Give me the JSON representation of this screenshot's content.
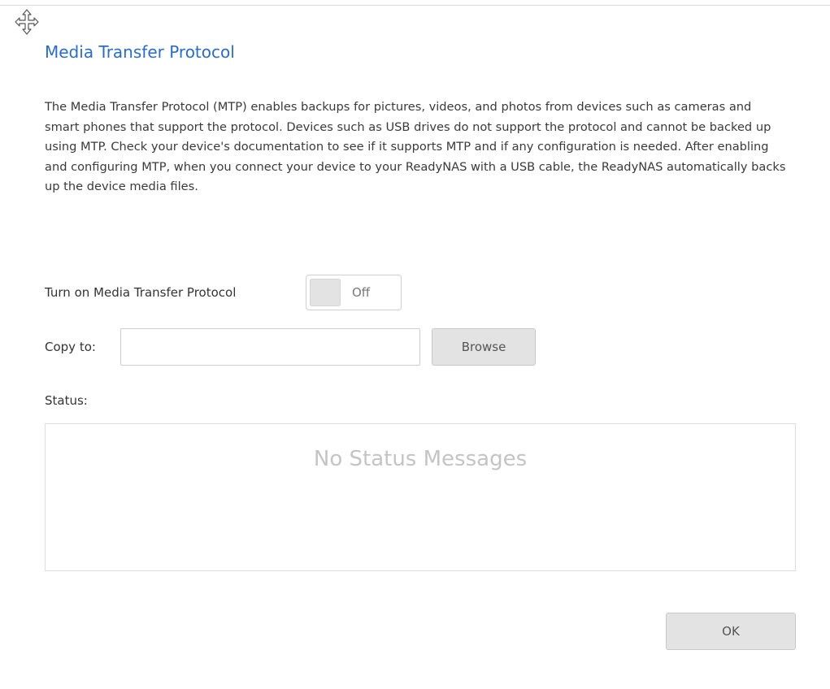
{
  "dialog": {
    "title": "Media Transfer Protocol",
    "description": "The Media Transfer Protocol (MTP) enables backups for pictures, videos, and photos from devices such as cameras and smart phones that support the protocol. Devices such as USB drives do not support the protocol and cannot be backed up using MTP. Check your device's documentation to see if it supports MTP and if any configuration is needed. After enabling and configuring MTP, when you connect your device to your ReadyNAS with a USB cable, the ReadyNAS automatically backs up the device media files.",
    "move_icon": "move-arrows-icon"
  },
  "mtp": {
    "label": "Turn on Media Transfer Protocol",
    "toggle_state": "Off"
  },
  "copy_to": {
    "label": "Copy to:",
    "value": "",
    "browse_label": "Browse"
  },
  "status": {
    "label": "Status:",
    "empty_message": "No Status Messages"
  },
  "footer": {
    "ok_label": "OK"
  },
  "colors": {
    "title": "#2b6cc4",
    "button_bg": "#e3e3e3",
    "placeholder_text": "#c4c4c4"
  }
}
